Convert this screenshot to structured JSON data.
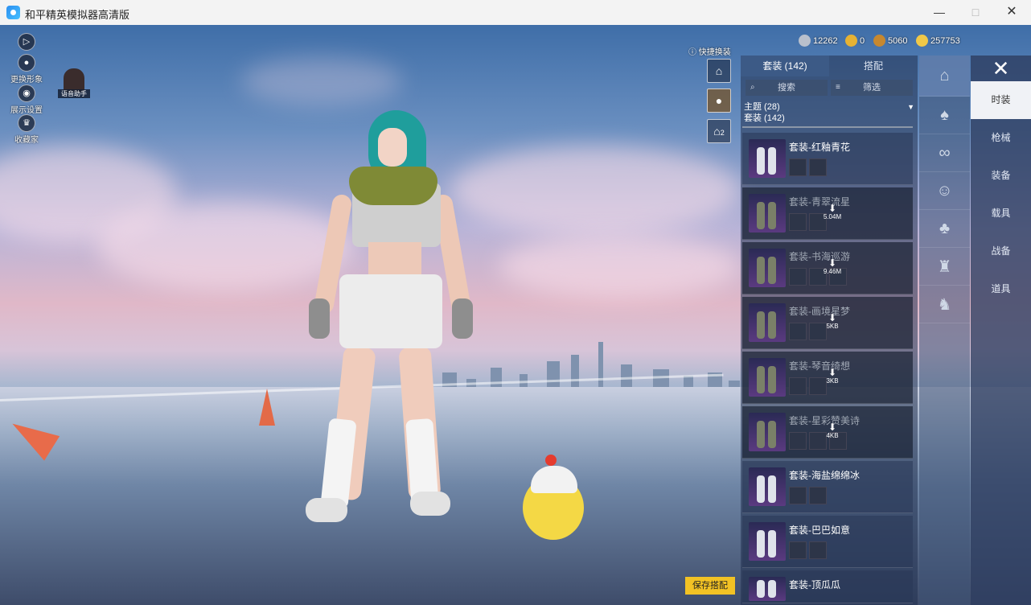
{
  "window": {
    "title": "和平精英模拟器高清版",
    "minimize": "—",
    "maximize": "□",
    "close": "✕"
  },
  "hud": {
    "expand_icon": "▷",
    "change_look": "更换形象",
    "display_settings": "展示设置",
    "collection": "收藏家",
    "voice_assistant": "语音助手"
  },
  "currencies": [
    {
      "icon": "silver-coin-icon",
      "value": "12262",
      "color": "#b9c0cc"
    },
    {
      "icon": "gold-coin-icon",
      "value": "0",
      "color": "#e6b233"
    },
    {
      "icon": "bronze-coin-icon",
      "value": "5060",
      "color": "#c7882f"
    },
    {
      "icon": "gold-bar-icon",
      "value": "257753",
      "color": "#f0c848"
    }
  ],
  "quick_change": {
    "label": "快捷换装",
    "slot2": "2"
  },
  "panel": {
    "tabs": [
      "套装 (142)",
      "搭配"
    ],
    "search": "搜索",
    "filter": "筛选",
    "theme_label": "主题 (28)",
    "set_label": "套装 (142)",
    "items": [
      {
        "name": "套装-红釉青花",
        "downloaded": true
      },
      {
        "name": "套装-青翠流星",
        "downloaded": false,
        "size": "5.04M"
      },
      {
        "name": "套装-书海巡游",
        "downloaded": false,
        "size": "9.46M"
      },
      {
        "name": "套装-画境星梦",
        "downloaded": false,
        "size": "5KB"
      },
      {
        "name": "套装-琴音绮想",
        "downloaded": false,
        "size": "3KB"
      },
      {
        "name": "套装-星彩赞美诗",
        "downloaded": false,
        "size": "4KB"
      },
      {
        "name": "套装-海盐绵绵冰",
        "downloaded": true
      },
      {
        "name": "套装-巴巴如意",
        "downloaded": true
      },
      {
        "name": "套装-顶瓜瓜",
        "downloaded": true
      }
    ]
  },
  "save_button": "保存搭配",
  "categories": [
    "时装",
    "枪械",
    "装备",
    "载具",
    "战备",
    "道具"
  ],
  "close_icon": "✕",
  "accent": "#f2c224"
}
